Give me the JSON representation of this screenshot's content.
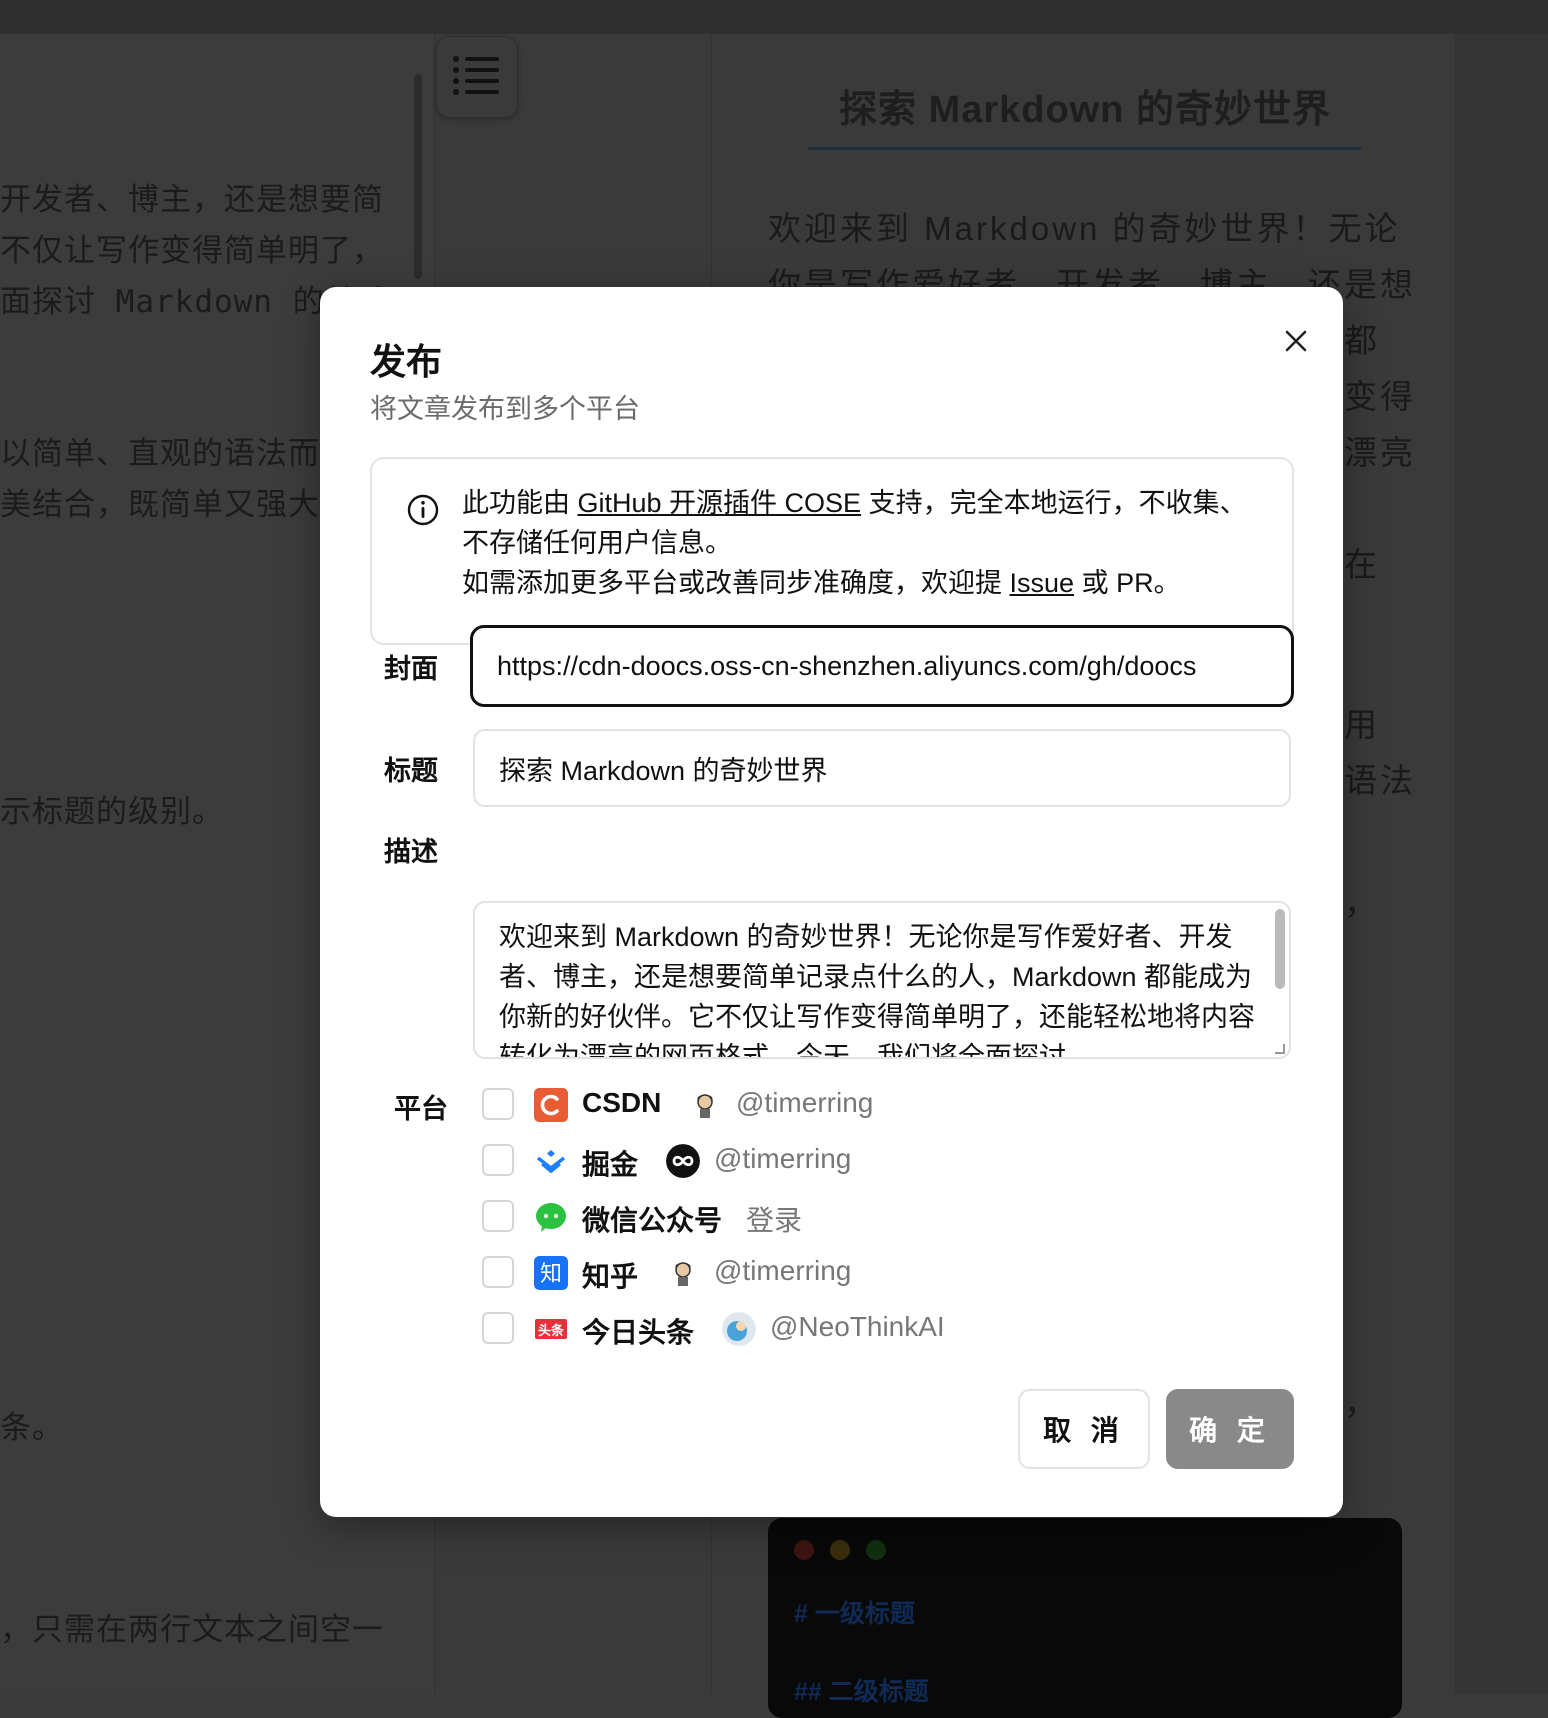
{
  "editor": {
    "lines": [
      "开发者、博主，还是想要简",
      "不仅让写作变得简单明了，",
      "面探讨 Markdown 的基础",
      "以简单、直观的语法而著",
      "美结合，既简单又强大",
      "示标题的级别。",
      "条。",
      "，只需在两行文本之间空一"
    ]
  },
  "preview": {
    "title": "探索 Markdown 的奇妙世界",
    "paragraph_lines": [
      "欢迎来到 Markdown 的奇妙世界！无论",
      "你是写作爱好者、开发者、博主，还是想"
    ],
    "right_fragments": [
      "都",
      "变得",
      "漂亮",
      "在",
      "用",
      "语法",
      "，",
      "，"
    ],
    "code_lines": [
      "#  一级标题",
      "##  二级标题"
    ]
  },
  "modal": {
    "title": "发布",
    "subtitle": "将文章发布到多个平台",
    "info": {
      "t1": "此功能由 ",
      "link1": "GitHub 开源插件 COSE",
      "t2": " 支持，完全本地运行，不收集、不存储任何用户信息。",
      "t3": "如需添加更多平台或改善同步准确度，欢迎提 ",
      "link2": "Issue",
      "t4": " 或 PR。"
    },
    "cover_label": "封面",
    "cover_value": "https://cdn-doocs.oss-cn-shenzhen.aliyuncs.com/gh/doocs",
    "title_label": "标题",
    "title_value": "探索 Markdown 的奇妙世界",
    "desc_label": "描述",
    "desc_value": "欢迎来到 Markdown 的奇妙世界！无论你是写作爱好者、开发者、博主，还是想要简单记录点什么的人，Markdown 都能成为你新的好伙伴。它不仅让写作变得简单明了，还能轻松地将内容转化为漂亮的网页格式。今天，我们将全面探讨",
    "platform_label": "平台",
    "platforms": [
      {
        "name": "CSDN",
        "user": "@timerring",
        "checked": false,
        "logo_color": "#e95d36"
      },
      {
        "name": "掘金",
        "user": "@timerring",
        "checked": false,
        "logo_color": "#1e80ff"
      },
      {
        "name": "微信公众号",
        "user": "登录",
        "checked": false,
        "logo_color": "#2ac240"
      },
      {
        "name": "知乎",
        "user": "@timerring",
        "checked": false,
        "logo_color": "#1772f6"
      },
      {
        "name": "今日头条",
        "user": "@NeoThinkAI",
        "checked": false,
        "logo_color": "#e8303b"
      }
    ],
    "cancel_label": "取 消",
    "ok_label": "确 定"
  }
}
